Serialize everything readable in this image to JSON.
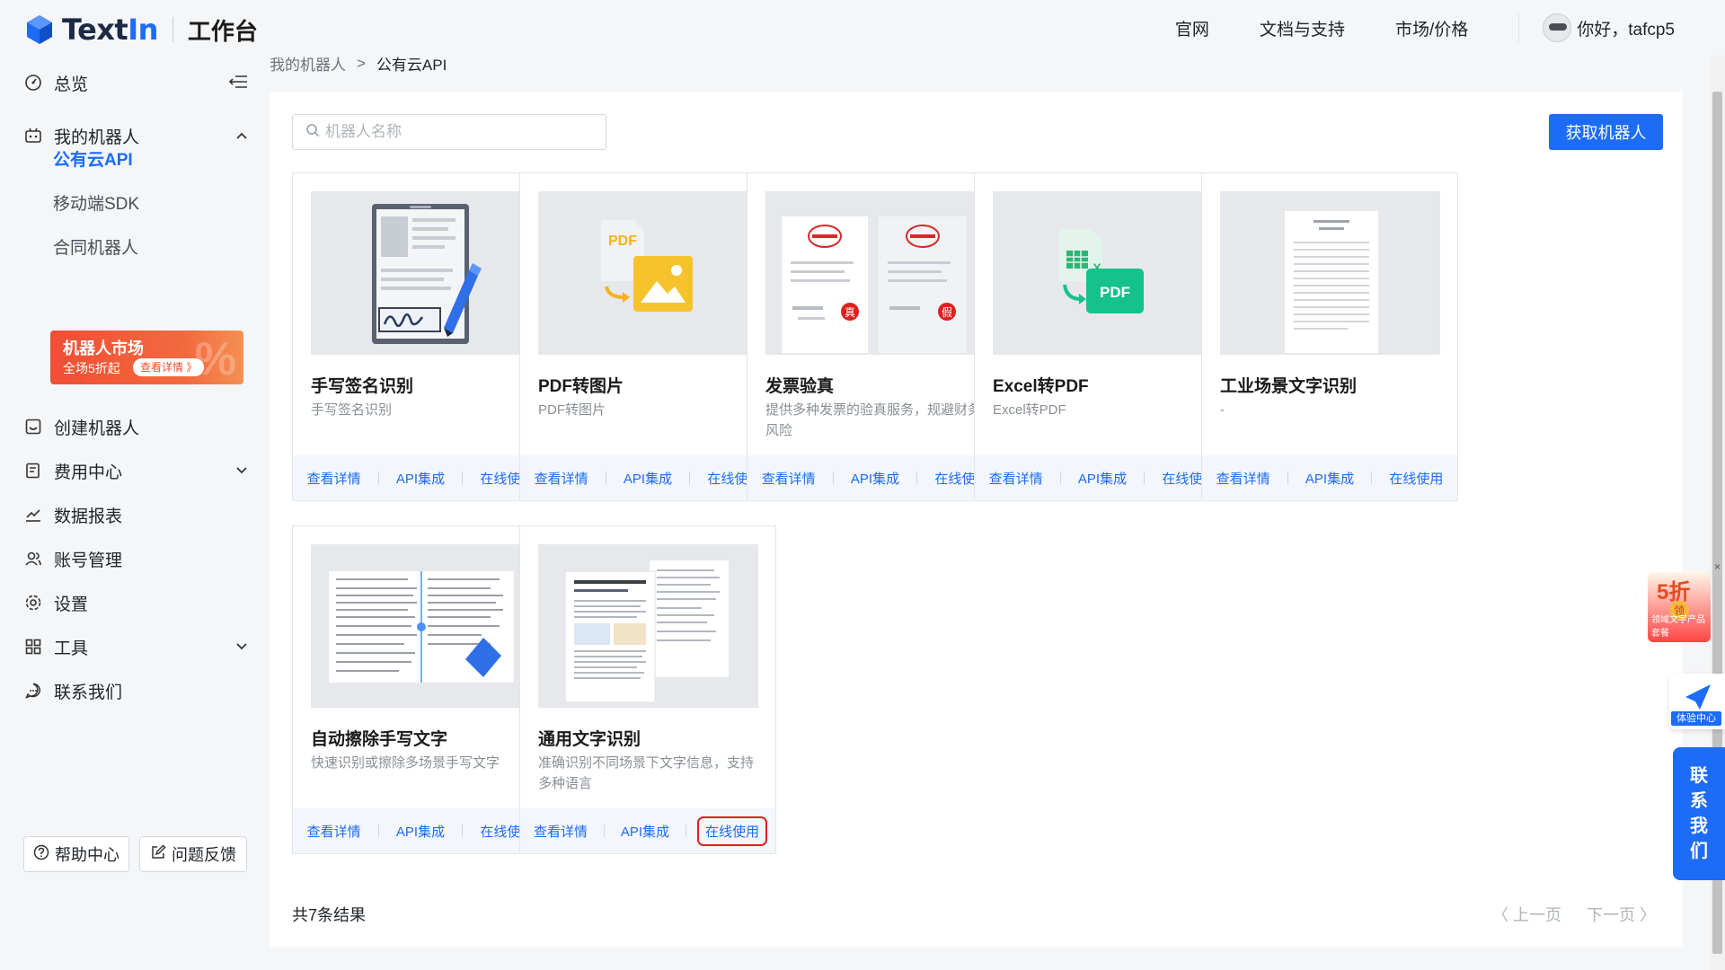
{
  "brand": {
    "name_part1": "Text",
    "name_part2": "In",
    "subtitle": "工作台"
  },
  "topnav": {
    "links": [
      "官网",
      "文档与支持",
      "市场/价格"
    ],
    "greeting": "你好，tafcp5"
  },
  "sidebar": {
    "items": [
      {
        "label": "总览"
      },
      {
        "label": "我的机器人"
      },
      {
        "label": "创建机器人"
      },
      {
        "label": "费用中心"
      },
      {
        "label": "数据报表"
      },
      {
        "label": "账号管理"
      },
      {
        "label": "设置"
      },
      {
        "label": "工具"
      },
      {
        "label": "联系我们"
      }
    ],
    "subitems": [
      "公有云API",
      "移动端SDK",
      "合同机器人"
    ],
    "promo": {
      "title": "机器人市场",
      "subtitle": "全场5折起",
      "pill": "查看详情 》",
      "mark": "%"
    },
    "help_label": "帮助中心",
    "feedback_label": "问题反馈"
  },
  "breadcrumb": {
    "parent": "我的机器人",
    "separator": ">",
    "current": "公有云API"
  },
  "search": {
    "placeholder": "机器人名称",
    "value": ""
  },
  "get_robot_label": "获取机器人",
  "action_labels": {
    "details": "查看详情",
    "api": "API集成",
    "online": "在线使用"
  },
  "cards": [
    {
      "title": "手写签名识别",
      "desc": "手写签名识别"
    },
    {
      "title": "PDF转图片",
      "desc": "PDF转图片"
    },
    {
      "title": "发票验真",
      "desc": "提供多种发票的验真服务，规避财务风险"
    },
    {
      "title": "Excel转PDF",
      "desc": "Excel转PDF"
    },
    {
      "title": "工业场景文字识别",
      "desc": "-"
    },
    {
      "title": "自动擦除手写文字",
      "desc": "快速识别或擦除多场景手写文字"
    },
    {
      "title": "通用文字识别",
      "desc": "准确识别不同场景下文字信息，支持多种语言"
    }
  ],
  "thumb_text": {
    "pdf": "PDF",
    "xlsx": "X",
    "real": "真",
    "fake": "假"
  },
  "result_total": "共7条结果",
  "pager": {
    "prev": "〈 上一页",
    "next": "下一页 〉"
  },
  "floats": {
    "sale_big": "5折",
    "sale_coin": "领",
    "sale_small": "领域文字产品套餐",
    "close": "×",
    "experience": "体验中心",
    "contact": [
      "联",
      "系",
      "我",
      "们"
    ]
  },
  "colors": {
    "accent": "#1c6cf5",
    "promo": "#f04e34",
    "highlight": "#e02020"
  }
}
